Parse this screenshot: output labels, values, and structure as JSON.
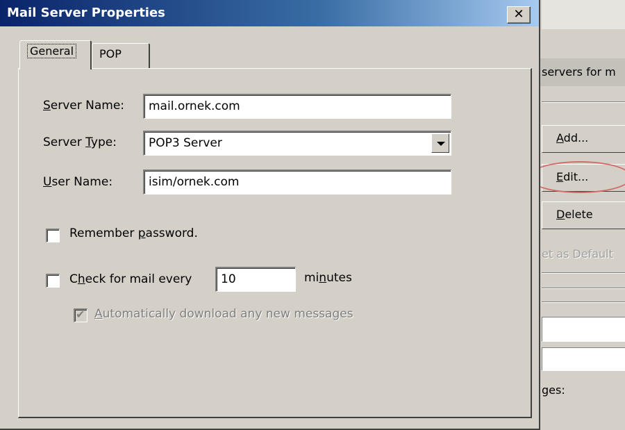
{
  "dialog": {
    "title": "Mail Server Properties",
    "close_glyph": "✕",
    "tabs": [
      "General",
      "POP"
    ],
    "active_tab": "General"
  },
  "form": {
    "server_name_label_u": "S",
    "server_name_label_rest": "erver Name:",
    "server_name_value": "mail.ornek.com",
    "server_type_label_pre": "Server ",
    "server_type_label_u": "T",
    "server_type_label_rest": "ype:",
    "server_type_value": "POP3 Server",
    "user_name_label_u": "U",
    "user_name_label_rest": "ser Name:",
    "user_name_value": "isim/ornek.com",
    "remember_pre": "Remember ",
    "remember_u": "p",
    "remember_rest": "assword.",
    "remember_checked": false,
    "check_mail_pre": "C",
    "check_mail_u": "h",
    "check_mail_rest": "eck for mail every",
    "check_mail_checked": false,
    "check_minutes_value": "10",
    "minutes_pre": "mi",
    "minutes_u": "n",
    "minutes_rest": "utes",
    "auto_download_u": "A",
    "auto_download_rest": "utomatically download any new messages",
    "auto_download_checked": true
  },
  "background": {
    "header_text": "servers for m",
    "add_u": "A",
    "add_rest": "dd...",
    "edit_u": "E",
    "edit_rest": "dit...",
    "delete_u": "D",
    "delete_rest": "elete",
    "set_default": "et as Default",
    "messages_label": "ges:"
  },
  "colors": {
    "titlebar_start": "#0a246a",
    "titlebar_end": "#a6caf0",
    "face": "#d4d0c8",
    "highlight_ellipse": "#d26a6a"
  }
}
